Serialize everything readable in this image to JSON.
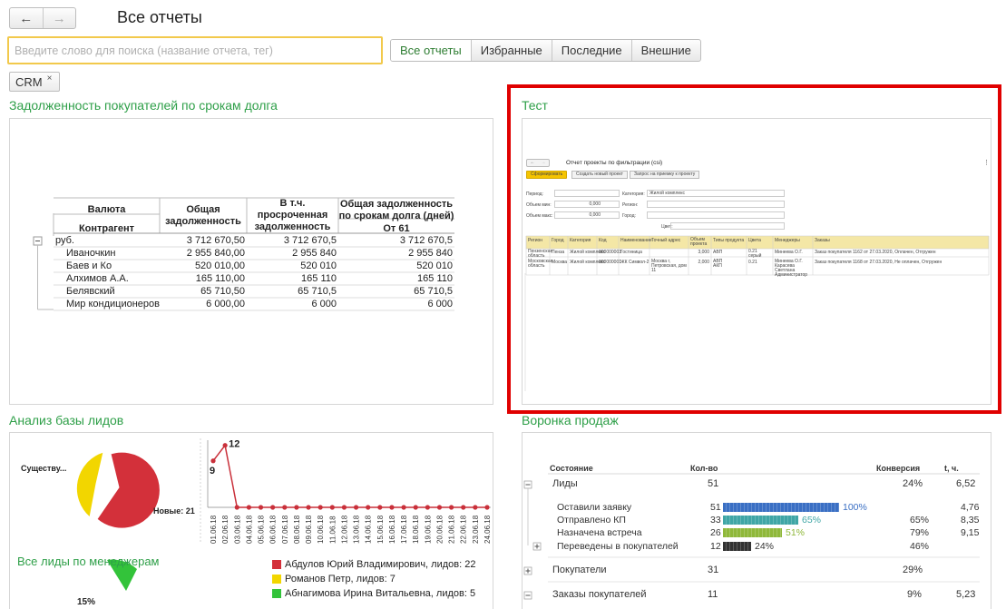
{
  "header": {
    "title": "Все отчеты",
    "back_icon": "←",
    "forward_icon": "→"
  },
  "search": {
    "placeholder": "Введите слово для поиска (название отчета, тег)",
    "value": ""
  },
  "filters": [
    "Все отчеты",
    "Избранные",
    "Последние",
    "Внешние"
  ],
  "tag": {
    "label": "CRM",
    "remove": "×"
  },
  "reports": {
    "debt": {
      "title": "Задолженность покупателей по срокам долга",
      "headers": {
        "currency": "Валюта",
        "counterparty": "Контрагент",
        "total": "Общая задолженность",
        "overdue": "В т.ч. просроченная задолженность",
        "bydays": "Общая задолженность по срокам долга (дней)",
        "from61": "От 61"
      },
      "rows": [
        {
          "name": "руб.",
          "total": "3 712 670,50",
          "overdue": "3 712 670,5",
          "d61": "3 712 670,5"
        },
        {
          "name": "Иваночкин",
          "total": "2 955 840,00",
          "overdue": "2 955 840",
          "d61": "2 955 840"
        },
        {
          "name": "Баев и Ко",
          "total": "520 010,00",
          "overdue": "520 010",
          "d61": "520 010"
        },
        {
          "name": "Алхимов А.А.",
          "total": "165 110,00",
          "overdue": "165 110",
          "d61": "165 110"
        },
        {
          "name": "Белявский",
          "total": "65 710,50",
          "overdue": "65 710,5",
          "d61": "65 710,5"
        },
        {
          "name": "Мир кондиционеров",
          "total": "6 000,00",
          "overdue": "6 000",
          "d61": "6 000"
        }
      ]
    },
    "test": {
      "title": "Тест",
      "mini": {
        "title": "Отчет проекты по фильтрации (csi)",
        "buttons": [
          "Сформировать",
          "Создать новый проект",
          "Запрос на приемку к проекту"
        ],
        "fields_left": [
          "Период:",
          "Объем мин:",
          "Объем макс:"
        ],
        "fields_left_values": [
          "",
          "0,000",
          "0,000"
        ],
        "fields_right": [
          "Категория:",
          "Регион:",
          "Город:",
          "Цвет:"
        ],
        "fields_right_values": [
          "Жилой комплекс",
          "",
          "",
          ""
        ],
        "columns": [
          "Регион",
          "Город",
          "Категория",
          "Код",
          "Наименование",
          "Точный адрес",
          "Объем проекта",
          "Типы продукта",
          "Цвета",
          "Менеджеры",
          "Заказы"
        ],
        "rows": [
          [
            "Пензенская область",
            "Пенза",
            "Жилой комплекс",
            "000000003",
            "Гостиница",
            "",
            "3,000",
            "АВП",
            "0.21 серый",
            "Минеева О.Г.",
            "Заказ покупателя 1162 от 27.03.2020, Оплачен, Отгружен"
          ],
          [
            "Московская область",
            "Москва",
            "Жилой комплекс",
            "000000001",
            "ЖК Символ-2",
            "Москва г, Петровская, дом 11",
            "2,000",
            "АВП АКП",
            "0.21",
            "Минеева О.Г. Карасева Светлана Администратор",
            "Заказ покупателя 1168 от 27.03.2020, Не оплачен, Отгружен"
          ]
        ]
      }
    },
    "leads": {
      "title": "Анализ базы лидов",
      "pie_labels": {
        "existing": "Существу...",
        "new": "Новые: 21"
      },
      "managers_title": "Все лиды по менеджерам",
      "legend": [
        {
          "label": "Абдулов Юрий Владимирович, лидов: 22",
          "color": "#d3303a"
        },
        {
          "label": "Романов Петр, лидов: 7",
          "color": "#f2d600"
        },
        {
          "label": "Абнагимова Ирина Витальевна, лидов: 5",
          "color": "#33c33a"
        }
      ],
      "pie2_label": "15%"
    },
    "funnel": {
      "title": "Воронка продаж",
      "headers": {
        "state": "Состояние",
        "count": "Кол-во",
        "conv": "Конверсия",
        "t": "t, ч."
      },
      "groups": [
        {
          "name": "Лиды",
          "count": "51",
          "conv": "24%",
          "t": "6,52"
        },
        {
          "name": "Покупатели",
          "count": "31",
          "conv": "29%",
          "t": ""
        },
        {
          "name": "Заказы покупателей",
          "count": "11",
          "conv": "9%",
          "t": "5,23"
        }
      ],
      "stages": [
        {
          "name": "Оставили заявку",
          "count": "51",
          "pct": "100%",
          "conv": "",
          "t": "4,76",
          "color": "#3a6fc4",
          "frac": 1.0,
          "pctColor": "#3a6fc4"
        },
        {
          "name": "Отправлено КП",
          "count": "33",
          "pct": "65%",
          "conv": "65%",
          "t": "8,35",
          "color": "#3fa6a6",
          "frac": 0.65,
          "pctColor": "#3fa6a6"
        },
        {
          "name": "Назначена встреча",
          "count": "26",
          "pct": "51%",
          "conv": "79%",
          "t": "9,15",
          "color": "#8fb83a",
          "frac": 0.51,
          "pctColor": "#8fb83a"
        },
        {
          "name": "Переведены в покупателей",
          "count": "12",
          "pct": "24%",
          "conv": "46%",
          "t": "",
          "color": "#333333",
          "frac": 0.24,
          "pctColor": "#333333"
        }
      ]
    }
  },
  "chart_data": {
    "type": "line",
    "x": [
      "01.06.18",
      "02.06.18",
      "03.06.18",
      "04.06.18",
      "05.06.18",
      "06.06.18",
      "07.06.18",
      "08.06.18",
      "09.06.18",
      "10.06.18",
      "11.06.18",
      "12.06.18",
      "13.06.18",
      "14.06.18",
      "15.06.18",
      "16.06.18",
      "17.06.18",
      "18.06.18",
      "19.06.18",
      "20.06.18",
      "21.06.18",
      "22.06.18",
      "23.06.18",
      "24.06.18"
    ],
    "tick_labels": [
      "01.06.18",
      "02.06.18",
      "03.06.18",
      "04.06.18",
      "05.06.18",
      "06.06.18",
      "07.06.18",
      "08.06.18",
      "09.06.18",
      "10.06.18",
      "11.06.18",
      "12.06.18",
      "13.06.18",
      "14.06.18",
      "15.06.18",
      "16.06.18",
      "17.06.18",
      "18.06.18",
      "19.06.18",
      "20.06.18",
      "21.06.18",
      "22.06.18",
      "23.06.18",
      "24.06.18"
    ],
    "values": [
      9,
      12,
      0,
      0,
      0,
      0,
      0,
      0,
      0,
      0,
      0,
      0,
      0,
      0,
      0,
      0,
      0,
      0,
      0,
      0,
      0,
      0,
      0,
      0
    ],
    "data_labels": [
      "9",
      "12"
    ],
    "ylim": [
      0,
      13
    ],
    "color": "#c9303a"
  }
}
